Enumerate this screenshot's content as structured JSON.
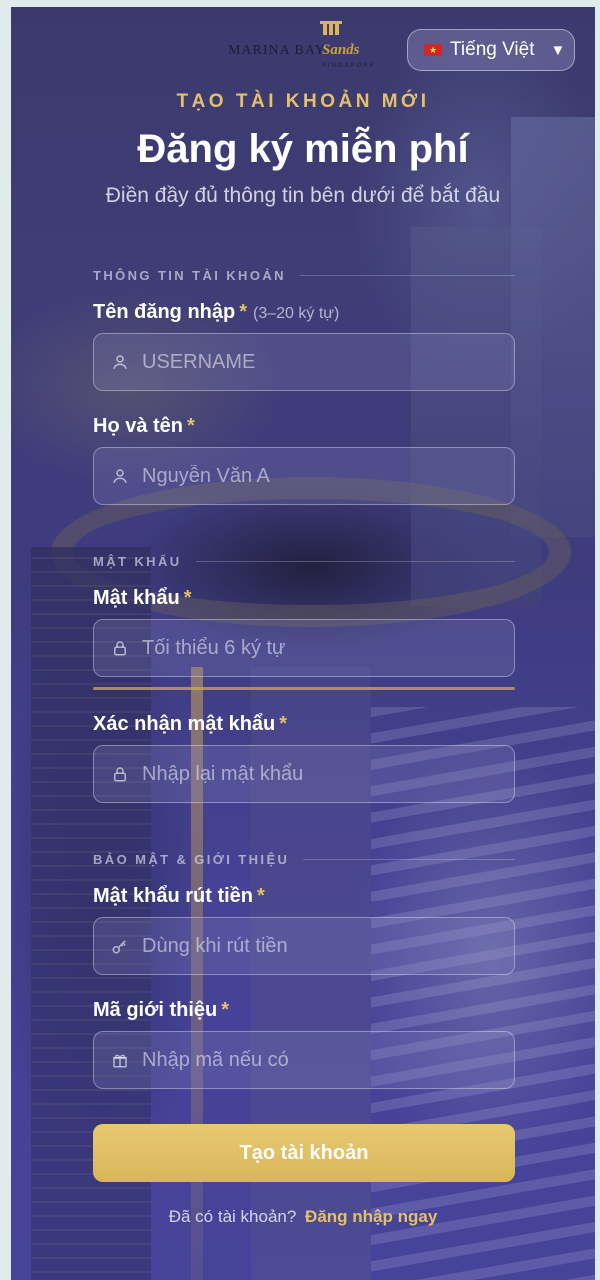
{
  "brand": {
    "logo_text": "MARINA BAY Sands SINGAPORE"
  },
  "language": {
    "label": "Tiếng Việt",
    "flag": "vn-flag-icon",
    "caret": "▼"
  },
  "header": {
    "eyebrow": "TẠO TÀI KHOẢN MỚI",
    "title": "Đăng ký miễn phí",
    "subtitle": "Điền đầy đủ thông tin bên dưới để bắt đầu"
  },
  "sections": {
    "account": "THÔNG TIN TÀI KHOẢN",
    "password": "MẬT KHẨU",
    "security": "BẢO MẬT & GIỚI THIỆU"
  },
  "fields": {
    "username": {
      "label": "Tên đăng nhập",
      "required": "*",
      "hint": "(3–20 ký tự)",
      "placeholder": "USERNAME",
      "icon": "user-icon"
    },
    "fullname": {
      "label": "Họ và tên",
      "required": "*",
      "placeholder": "Nguyễn Văn A",
      "icon": "user-icon"
    },
    "password": {
      "label": "Mật khẩu",
      "required": "*",
      "placeholder": "Tối thiểu 6 ký tự",
      "icon": "lock-icon"
    },
    "confirm_password": {
      "label": "Xác nhận mật khẩu",
      "required": "*",
      "placeholder": "Nhập lại mật khẩu",
      "icon": "lock-icon"
    },
    "withdraw_password": {
      "label": "Mật khẩu rút tiền",
      "required": "*",
      "placeholder": "Dùng khi rút tiền",
      "icon": "key-icon"
    },
    "referral_code": {
      "label": "Mã giới thiệu",
      "required": "*",
      "placeholder": "Nhập mã nếu có",
      "icon": "gift-icon"
    }
  },
  "submit_label": "Tạo tài khoản",
  "footer": {
    "question": "Đã có tài khoản?",
    "login_link": "Đăng nhập ngay"
  },
  "colors": {
    "accent_gold": "#e4c068",
    "button_gold": "#e0c065",
    "background_purple": "#403e80"
  }
}
